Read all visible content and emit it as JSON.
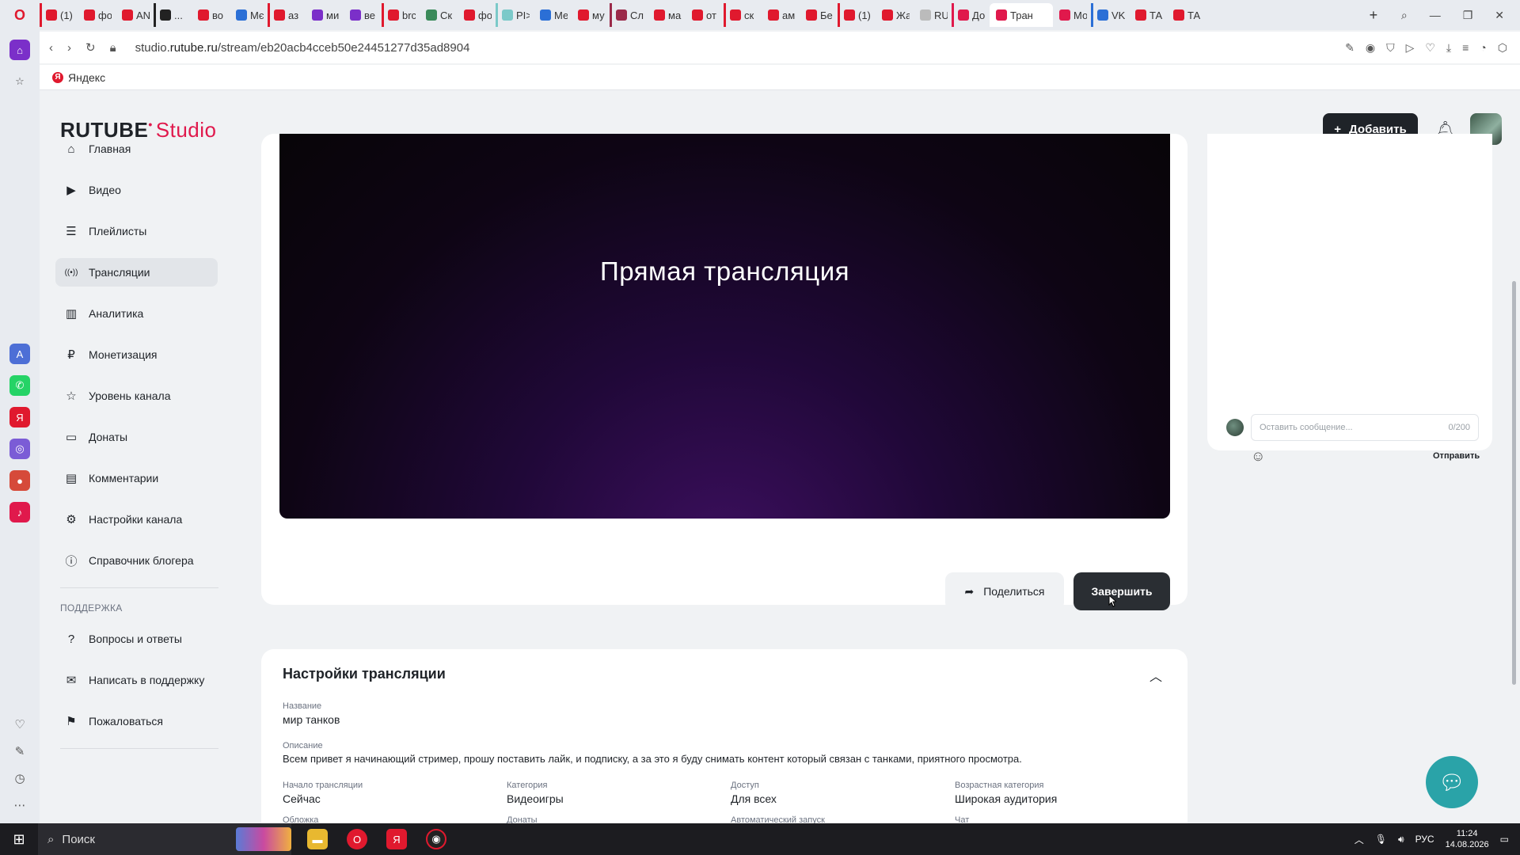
{
  "browser": {
    "tabs": [
      {
        "label": "(1)",
        "color": "#e0192e"
      },
      {
        "label": "фо",
        "color": "#e0192e"
      },
      {
        "label": "AN",
        "color": "#e0192e"
      },
      {
        "label": "...",
        "color": "#222222"
      },
      {
        "label": "во",
        "color": "#e0192e"
      },
      {
        "label": "Мє",
        "color": "#2b6fd6"
      },
      {
        "label": "аз",
        "color": "#e0192e"
      },
      {
        "label": "ми",
        "color": "#7b2fc9"
      },
      {
        "label": "ве",
        "color": "#7b2fc9"
      },
      {
        "label": "brc",
        "color": "#e0192e"
      },
      {
        "label": "Ск",
        "color": "#3a8a5a"
      },
      {
        "label": "фо",
        "color": "#e0192e"
      },
      {
        "label": "PI>",
        "color": "#7bc9c9"
      },
      {
        "label": "Ме",
        "color": "#2b6fd6"
      },
      {
        "label": "му",
        "color": "#e0192e"
      },
      {
        "label": "Сл",
        "color": "#9b2a4a"
      },
      {
        "label": "ма",
        "color": "#e0192e"
      },
      {
        "label": "от",
        "color": "#e0192e"
      },
      {
        "label": "ск",
        "color": "#e0192e"
      },
      {
        "label": "ам",
        "color": "#e0192e"
      },
      {
        "label": "Бе",
        "color": "#e0192e"
      },
      {
        "label": "(1)",
        "color": "#e0192e"
      },
      {
        "label": "Жа",
        "color": "#e0192e"
      },
      {
        "label": "RU",
        "color": "#bbbbbb"
      },
      {
        "label": "До",
        "color": "#e0194c"
      },
      {
        "label": "Транс",
        "color": "#e0194c",
        "active": true
      },
      {
        "label": "Мо",
        "color": "#e0194c"
      },
      {
        "label": "VK",
        "color": "#2b6fd6"
      },
      {
        "label": "ТА",
        "color": "#e0192e"
      },
      {
        "label": "ТА",
        "color": "#e0192e"
      }
    ],
    "url_prefix": "studio.",
    "url_domain": "rutube.ru",
    "url_path": "/stream/eb20acb4cceb50e24451277d35ad8904",
    "bookmark": "Яндекс"
  },
  "header": {
    "logo_main": "RUTUBE",
    "logo_studio": "Studio",
    "add_label": "Добавить"
  },
  "nav": {
    "items": [
      {
        "label": "Главная",
        "icon": "home-icon",
        "glyph": "⌂"
      },
      {
        "label": "Видео",
        "icon": "video-icon",
        "glyph": "▶"
      },
      {
        "label": "Плейлисты",
        "icon": "playlist-icon",
        "glyph": "☰"
      },
      {
        "label": "Трансляции",
        "icon": "broadcast-icon",
        "glyph": "((•))",
        "active": true
      },
      {
        "label": "Аналитика",
        "icon": "analytics-icon",
        "glyph": "▥"
      },
      {
        "label": "Монетизация",
        "icon": "ruble-icon",
        "glyph": "₽"
      },
      {
        "label": "Уровень канала",
        "icon": "star-icon",
        "glyph": "☆"
      },
      {
        "label": "Донаты",
        "icon": "wallet-icon",
        "glyph": "▭"
      },
      {
        "label": "Комментарии",
        "icon": "comment-icon",
        "glyph": "▤"
      },
      {
        "label": "Настройки канала",
        "icon": "gear-icon",
        "glyph": "⚙"
      },
      {
        "label": "Справочник блогера",
        "icon": "info-icon",
        "glyph": "ⓘ"
      }
    ],
    "support_heading": "ПОДДЕРЖКА",
    "support_items": [
      {
        "label": "Вопросы и ответы",
        "icon": "question-icon",
        "glyph": "?"
      },
      {
        "label": "Написать в поддержку",
        "icon": "mail-icon",
        "glyph": "✉"
      },
      {
        "label": "Пожаловаться",
        "icon": "flag-icon",
        "glyph": "⚑"
      }
    ]
  },
  "player": {
    "title": "Прямая трансляция",
    "share_label": "Поделиться",
    "finish_label": "Завершить"
  },
  "chat": {
    "placeholder": "Оставить сообщение...",
    "counter": "0/200",
    "send_label": "Отправить"
  },
  "settings": {
    "title": "Настройки трансляции",
    "name_label": "Название",
    "name_value": "мир танков",
    "description_label": "Описание",
    "description_value": "Всем привет я начинающий стример, прошу поставить лайк, и подписку, а за это я буду снимать контент который связан с танками, приятного просмотра.",
    "fields": [
      {
        "label": "Начало трансляции",
        "value": "Сейчас"
      },
      {
        "label": "Категория",
        "value": "Видеоигры"
      },
      {
        "label": "Доступ",
        "value": "Для всех"
      },
      {
        "label": "Возрастная категория",
        "value": "Широкая аудитория"
      }
    ],
    "next_row": [
      "Обложка",
      "Донаты",
      "Автоматический запуск",
      "Чат"
    ]
  },
  "taskbar": {
    "search": "Поиск",
    "lang": "РУС",
    "time": "11:24",
    "date": "14.08.2026"
  },
  "colors": {
    "accent": "#e0194c",
    "dark": "#1f2328",
    "help": "#2aa3a8"
  }
}
